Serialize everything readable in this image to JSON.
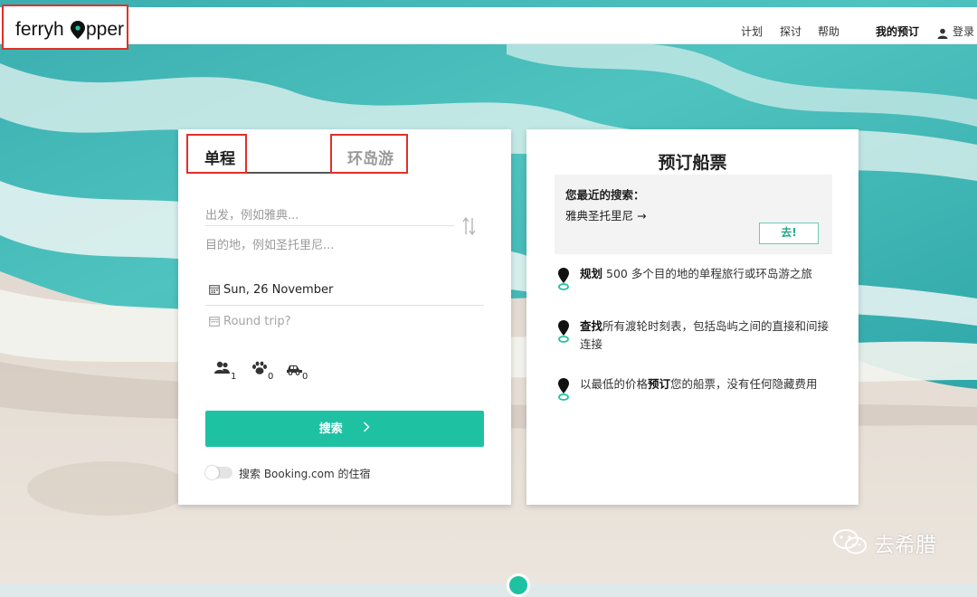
{
  "header": {
    "logo_text": "ferryhopper",
    "nav": [
      {
        "label": "计划"
      },
      {
        "label": "探讨"
      },
      {
        "label": "帮助"
      }
    ],
    "my_bookings": "我的预订",
    "login": "登录"
  },
  "search_card": {
    "tabs": [
      {
        "label": "单程"
      },
      {
        "label": "环岛游"
      }
    ],
    "from_placeholder": "出发，例如雅典...",
    "to_placeholder": "目的地，例如圣托里尼...",
    "date_value": "Sun, 26 November",
    "return_placeholder": "Round trip?",
    "passengers_count": "1",
    "pets_count": "0",
    "vehicles_count": "0",
    "search_label": "搜索",
    "booking_toggle_label": "搜索 Booking.com 的住宿"
  },
  "info_card": {
    "title": "预订船票",
    "recent_title": "您最近的搜索：",
    "recent_item": "雅典圣托里尼 →",
    "go_label": "去!",
    "features": [
      {
        "bold": "规划",
        "text": " 500 多个目的地的单程旅行或环岛游之旅"
      },
      {
        "bold": "查找",
        "text": "所有渡轮时刻表，包括岛屿之间的直接和间接连接"
      },
      {
        "pre": "以最低的价格",
        "bold": "预订",
        "text": "您的船票，没有任何隐藏费用"
      }
    ]
  },
  "watermark": "去希腊",
  "colors": {
    "accent": "#1ec2a3",
    "highlight_border": "#e0302a"
  },
  "icons": [
    "map-pin-icon",
    "swap-icon",
    "calendar-icon",
    "passengers-icon",
    "paw-icon",
    "car-icon",
    "user-icon",
    "chevron-right-icon",
    "wechat-icon"
  ]
}
